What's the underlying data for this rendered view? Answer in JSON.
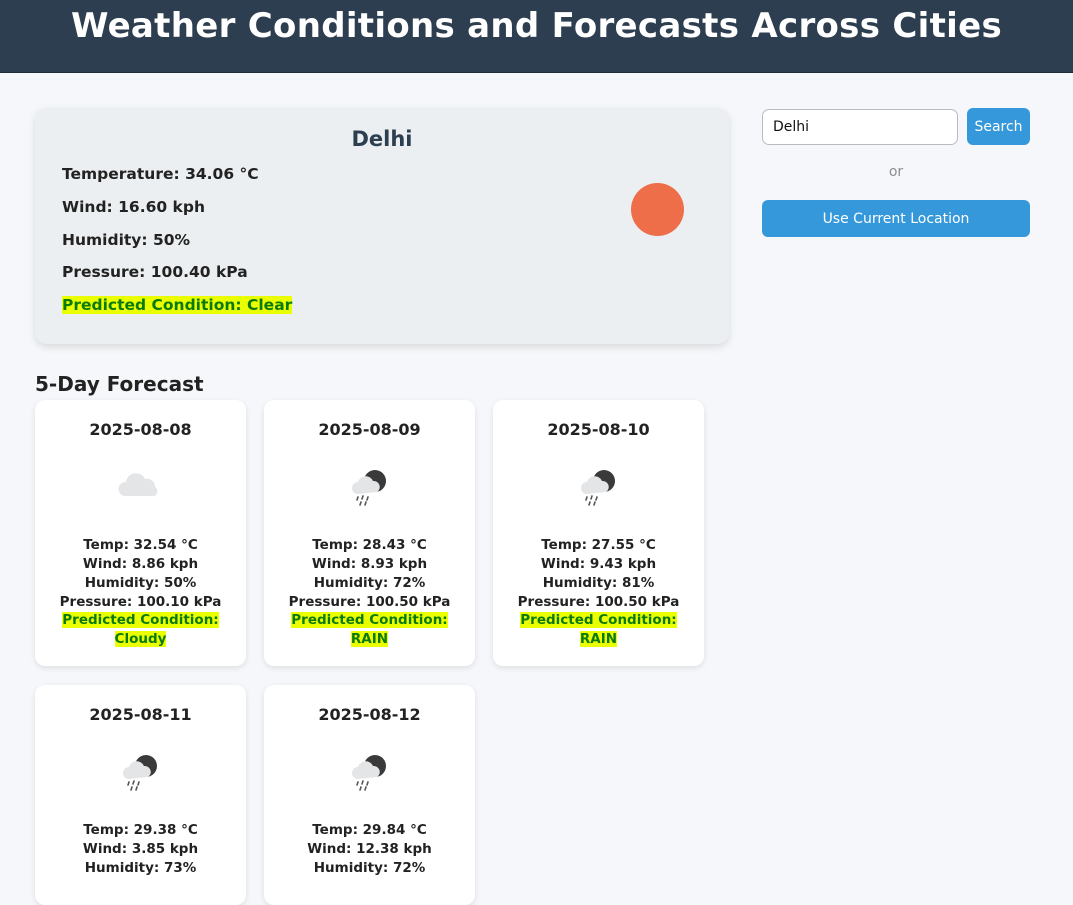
{
  "header": {
    "title": "Weather Conditions and Forecasts Across Cities"
  },
  "current": {
    "city": "Delhi",
    "temperature": "Temperature: 34.06 °C",
    "wind": "Wind: 16.60 kph",
    "humidity": "Humidity: 50%",
    "pressure": "Pressure: 100.40 kPa",
    "condition": "Predicted Condition: Clear",
    "icon": "sun-icon",
    "icon_color": "#ee6e4a"
  },
  "search": {
    "value": "Delhi",
    "button_label": "Search",
    "or_label": "or",
    "location_button_label": "Use Current Location"
  },
  "forecast": {
    "title": "5-Day Forecast",
    "days": [
      {
        "date": "2025-08-08",
        "icon": "cloud-icon",
        "temp": "Temp: 32.54 °C",
        "wind": "Wind: 8.86 kph",
        "humidity": "Humidity: 50%",
        "pressure": "Pressure: 100.10 kPa",
        "condition_label": "Predicted Condition:",
        "condition_value": "Cloudy"
      },
      {
        "date": "2025-08-09",
        "icon": "rain-night-icon",
        "temp": "Temp: 28.43 °C",
        "wind": "Wind: 8.93 kph",
        "humidity": "Humidity: 72%",
        "pressure": "Pressure: 100.50 kPa",
        "condition_label": "Predicted Condition:",
        "condition_value": "RAIN"
      },
      {
        "date": "2025-08-10",
        "icon": "rain-night-icon",
        "temp": "Temp: 27.55 °C",
        "wind": "Wind: 9.43 kph",
        "humidity": "Humidity: 81%",
        "pressure": "Pressure: 100.50 kPa",
        "condition_label": "Predicted Condition:",
        "condition_value": "RAIN"
      },
      {
        "date": "2025-08-11",
        "icon": "rain-night-icon",
        "temp": "Temp: 29.38 °C",
        "wind": "Wind: 3.85 kph",
        "humidity": "Humidity: 73%"
      },
      {
        "date": "2025-08-12",
        "icon": "rain-night-icon",
        "temp": "Temp: 29.84 °C",
        "wind": "Wind: 12.38 kph",
        "humidity": "Humidity: 72%"
      }
    ]
  },
  "colors": {
    "header_bg": "#2c3e50",
    "accent": "#3498db",
    "highlight_bg": "#eaff00",
    "highlight_text": "#0b7a0b"
  }
}
